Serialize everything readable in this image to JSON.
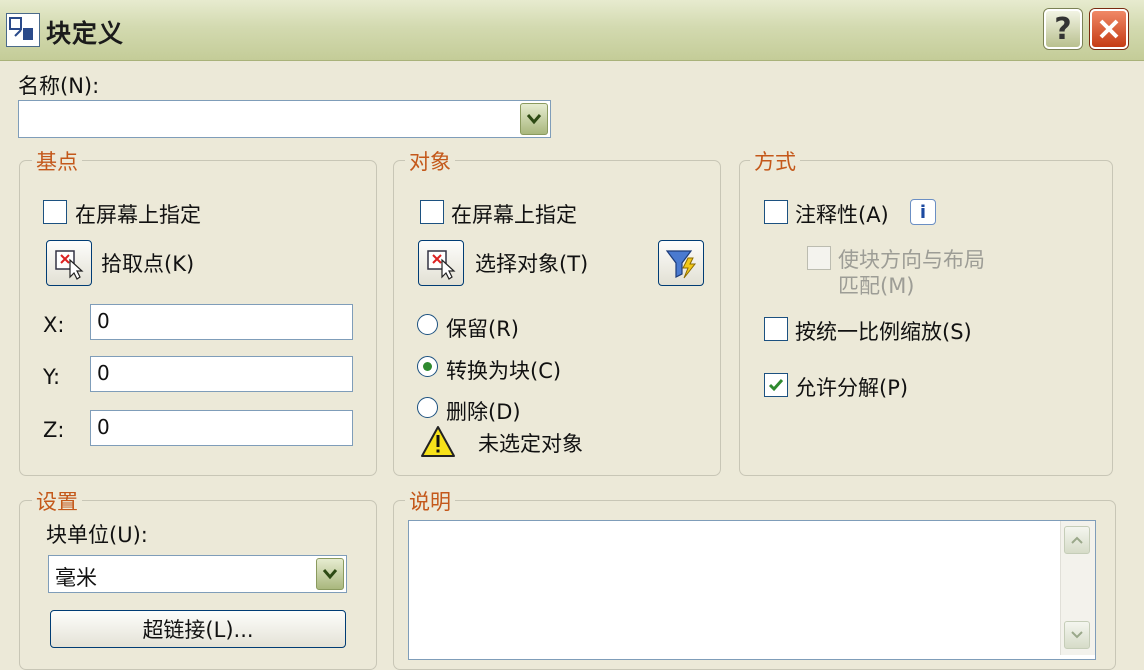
{
  "window": {
    "title": "块定义"
  },
  "name": {
    "label": "名称(N):",
    "value": ""
  },
  "base_point": {
    "title": "基点",
    "specify_on_screen": "在屏幕上指定",
    "pick_point": "拾取点(K)",
    "x_label": "X:",
    "x_value": "0",
    "y_label": "Y:",
    "y_value": "0",
    "z_label": "Z:",
    "z_value": "0"
  },
  "objects": {
    "title": "对象",
    "specify_on_screen": "在屏幕上指定",
    "select_objects": "选择对象(T)",
    "retain": "保留(R)",
    "convert": "转换为块(C)",
    "delete": "删除(D)",
    "warning": "未选定对象",
    "selected": "convert"
  },
  "behavior": {
    "title": "方式",
    "annotative": "注释性(A)",
    "match_orientation_1": "使块方向与布局",
    "match_orientation_2": "匹配(M)",
    "scale_uniformly": "按统一比例缩放(S)",
    "allow_explode": "允许分解(P)",
    "annotative_checked": false,
    "scale_uniformly_checked": false,
    "allow_explode_checked": true
  },
  "settings": {
    "title": "设置",
    "block_unit_label": "块单位(U):",
    "block_unit_value": "毫米",
    "hyperlink": "超链接(L)..."
  },
  "description": {
    "title": "说明",
    "value": ""
  },
  "colors": {
    "accent": "#c4581a",
    "checkmark": "#2f8a2f"
  }
}
